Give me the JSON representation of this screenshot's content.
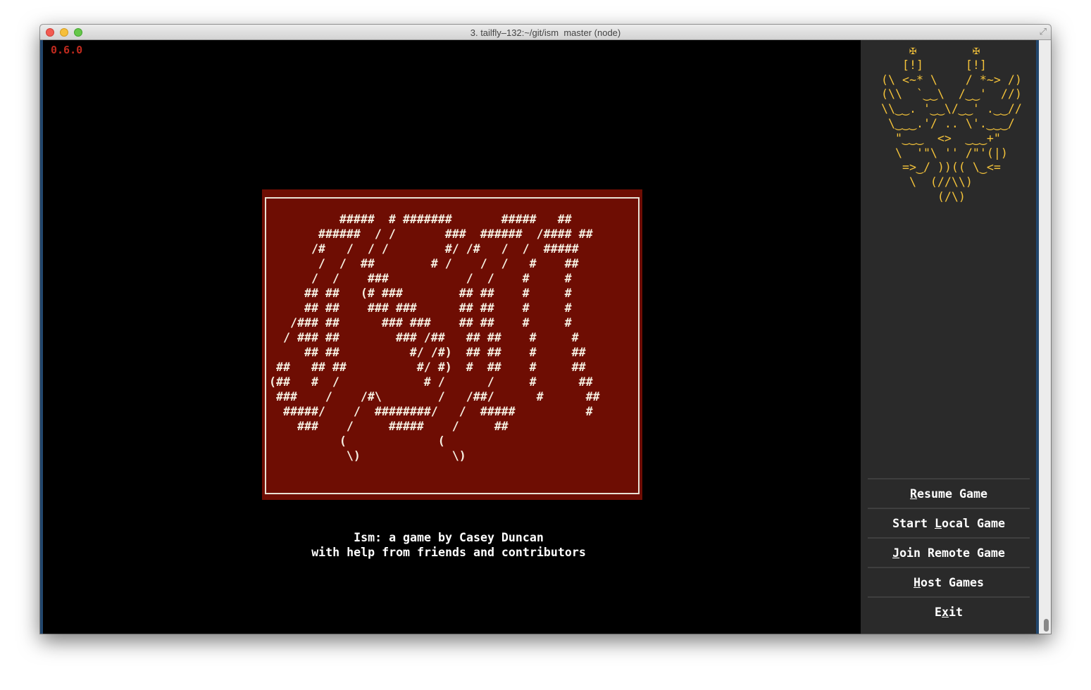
{
  "window": {
    "title": "3. tailfly–132:~/git/ism  master (node)"
  },
  "terminal": {
    "version": "0.6.0",
    "logo_art": "          #####  # #######       #####   ##\n       ######  / /       ###  ######  /#### ##\n      /#   /  / /        #/ /#   /  /  #####\n       /  /  ##        # /    /  /   #    ##\n      /  /    ###           /  /    #     #\n     ## ##   (# ###        ## ##    #     #\n     ## ##    ### ###      ## ##    #     #\n   /### ##      ### ###    ## ##    #     #\n  / ### ##        ### /##   ## ##    #     #\n     ## ##          #/ /#)  ## ##    #     ##\n ##   ## ##          #/ #)  #  ##    #     ##\n(##   #  /            # /      /     #      ##\n ###    /    /#\\        /   /##/      #      ##\n  #####/    /  ########/   /  #####          #\n    ###    /     #####    /     ##\n          (             (\n           \\)             \\)",
    "credits": [
      "Ism: a game by Casey Duncan",
      "with help from friends and contributors"
    ]
  },
  "sidebar": {
    "owl_art": "    ✠        ✠\n   [!]      [!]\n(\\ <~* \\    / *~> /)\n(\\\\  `‿‿\\  /‿‿'  //)\n\\\\‿‿. '‿‿\\/‿‿' .‿‿//\n \\‿‿‿.'/ .. \\'.‿‿‿/\n  \"‿‿‿  <>  ‿‿‿+\"\n  \\  '\"\\ '' /\"'(|)\n   =>‿/ ))(( \\‿<=\n    \\  (//\\\\)\n        (/\\)",
    "menu": [
      {
        "pre": "",
        "hot": "R",
        "post": "esume Game"
      },
      {
        "pre": "Start ",
        "hot": "L",
        "post": "ocal Game"
      },
      {
        "pre": "",
        "hot": "J",
        "post": "oin Remote Game"
      },
      {
        "pre": "",
        "hot": "H",
        "post": "ost Games"
      },
      {
        "pre": "E",
        "hot": "x",
        "post": "it"
      }
    ]
  }
}
